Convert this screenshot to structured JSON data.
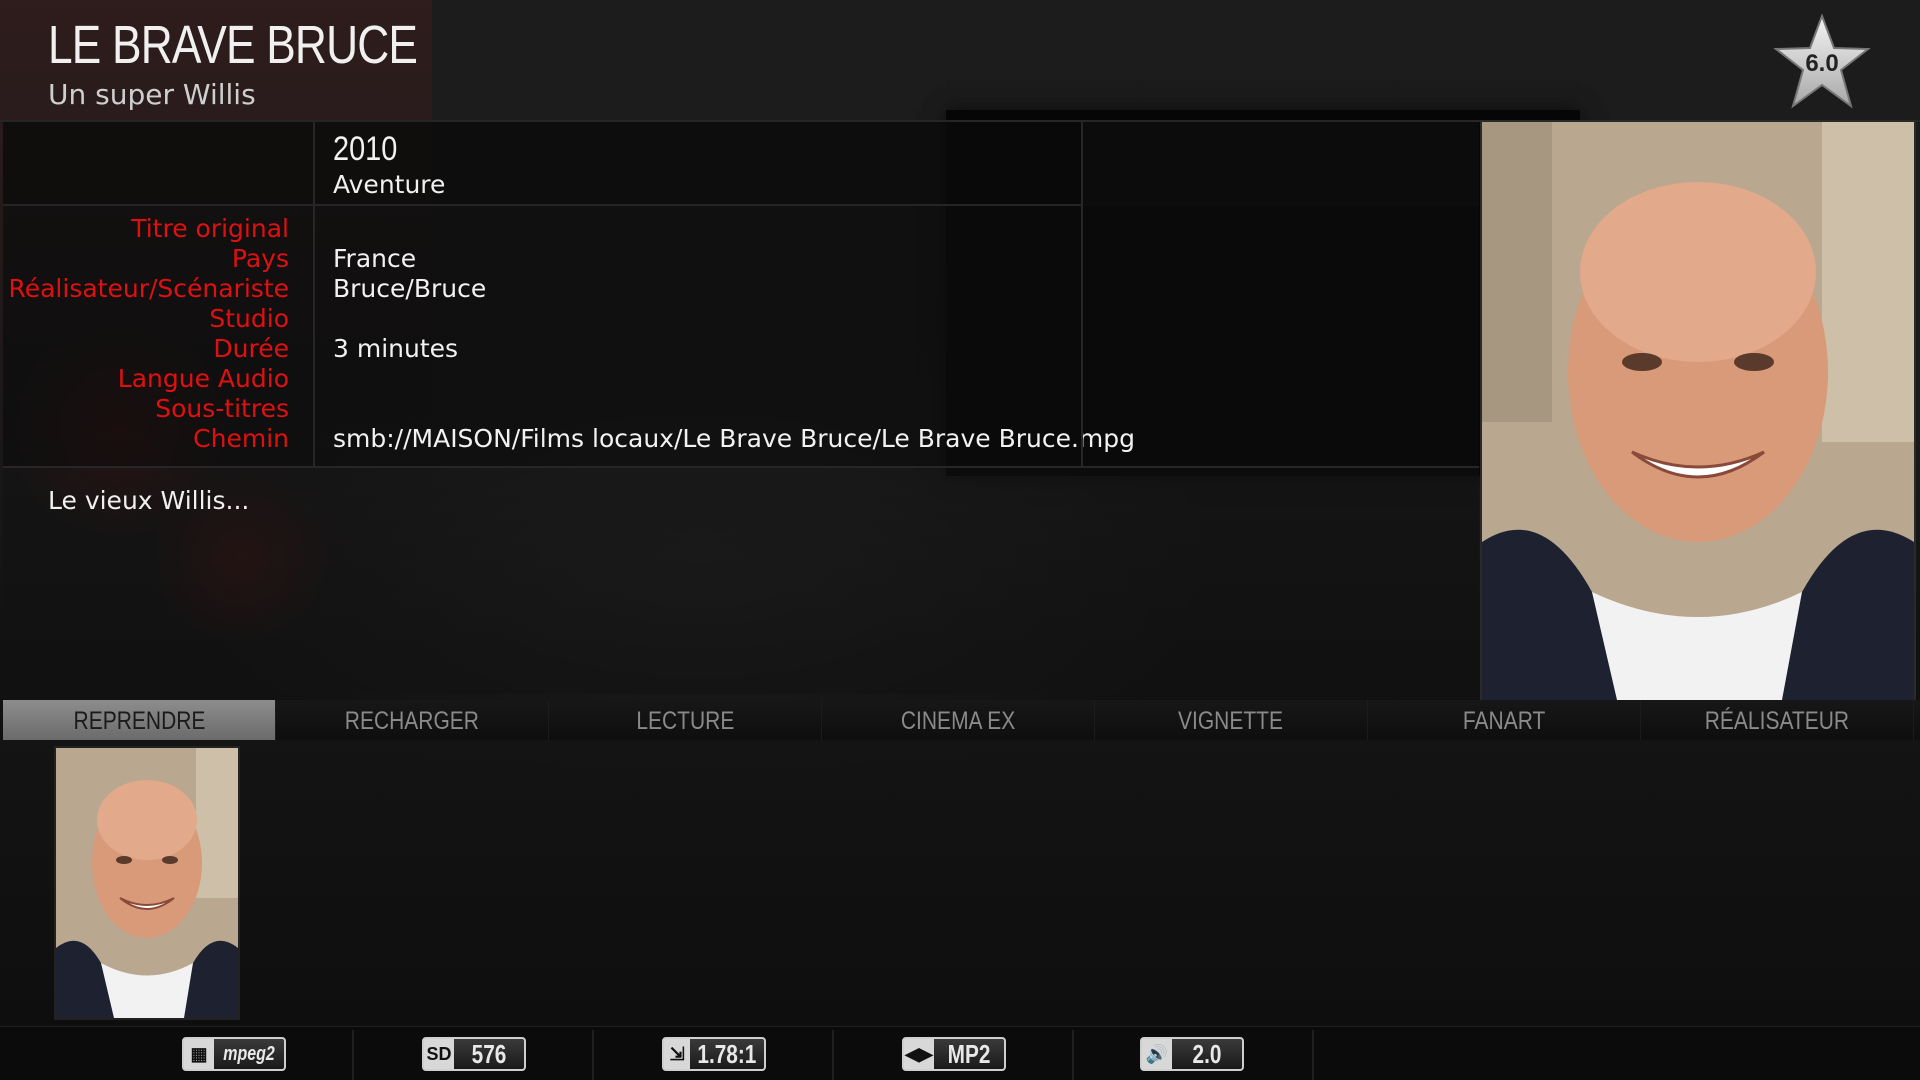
{
  "header": {
    "title": "LE BRAVE BRUCE",
    "subtitle": "Un super Willis",
    "rating": "6.0"
  },
  "movie": {
    "year": "2010",
    "genre": "Aventure",
    "plot": "Le vieux Willis..."
  },
  "details": {
    "labels": {
      "original_title": "Titre original",
      "country": "Pays",
      "director_writer": "Réalisateur/Scénariste",
      "studio": "Studio",
      "duration": "Durée",
      "audio_language": "Langue Audio",
      "subtitles": "Sous-titres",
      "path": "Chemin"
    },
    "values": {
      "original_title": "",
      "country": "France",
      "director_writer": "Bruce/Bruce",
      "studio": "",
      "duration": "3 minutes",
      "audio_language": "",
      "subtitles": "",
      "path": "smb://MAISON/Films locaux/Le Brave Bruce/Le Brave Bruce.mpg"
    }
  },
  "tabs": [
    {
      "label": "REPRENDRE",
      "active": true
    },
    {
      "label": "RECHARGER",
      "active": false
    },
    {
      "label": "LECTURE",
      "active": false
    },
    {
      "label": "CINEMA EX",
      "active": false
    },
    {
      "label": "VIGNETTE",
      "active": false
    },
    {
      "label": "FANART",
      "active": false
    },
    {
      "label": "RÉALISATEUR",
      "active": false
    }
  ],
  "flags": [
    {
      "icon": "video-codec-icon",
      "text": "mpeg2"
    },
    {
      "icon": "sd-icon",
      "icon_text": "SD",
      "text": "576"
    },
    {
      "icon": "aspect-ratio-icon",
      "text": "1.78:1"
    },
    {
      "icon": "audio-codec-icon",
      "text": "MP2"
    },
    {
      "icon": "audio-channels-icon",
      "text": "2.0"
    }
  ],
  "colors": {
    "label_red": "#e01010",
    "active_tab": "#7a7a7a",
    "background": "#121212"
  }
}
